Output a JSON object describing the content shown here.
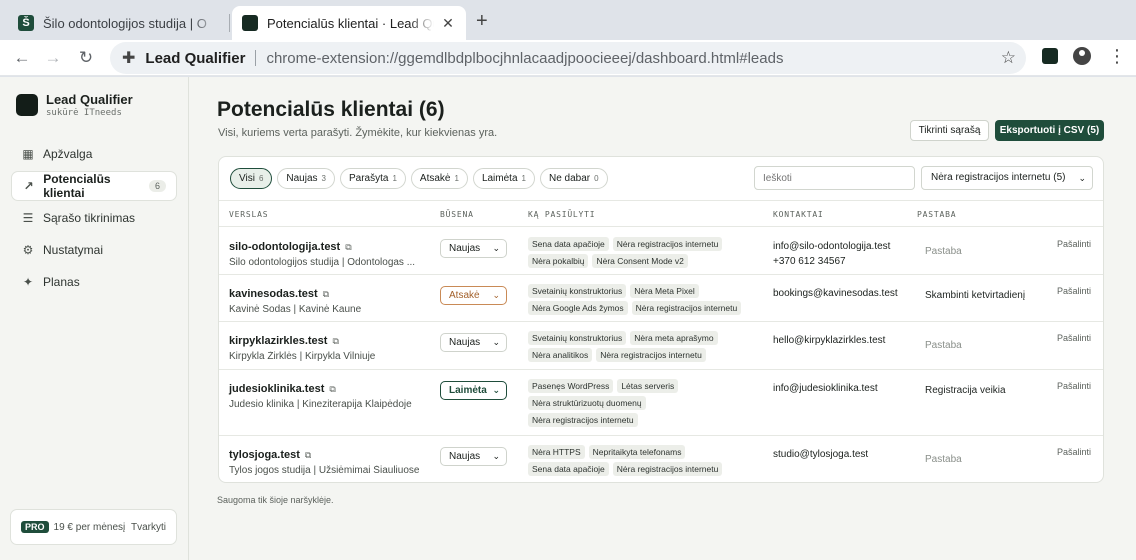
{
  "browser": {
    "tabs": [
      {
        "title": "Šilo odontologijos studija | O",
        "favicon": "Š",
        "active": false
      },
      {
        "title": "Potencialūs klientai · Lead Qualifier",
        "active": true
      }
    ],
    "new_tab": "+",
    "site_label": "Lead Qualifier",
    "url": "chrome-extension://ggemdlbdplbocjhnlacaadjpoocieeej/dashboard.html#leads"
  },
  "sidebar": {
    "brand_name": "Lead Qualifier",
    "brand_sub": "sukūrė ITneeds",
    "items": [
      {
        "label": "Apžvalga",
        "icon": "grid-icon"
      },
      {
        "label": "Potencialūs klientai",
        "icon": "leads-icon",
        "count": "6"
      },
      {
        "label": "Sąrašo tikrinimas",
        "icon": "list-check-icon"
      },
      {
        "label": "Nustatymai",
        "icon": "sliders-icon"
      },
      {
        "label": "Planas",
        "icon": "sparkle-icon"
      }
    ],
    "plan": {
      "badge": "PRO",
      "price": "19 € per mėnesį",
      "manage": "Tvarkyti"
    }
  },
  "main": {
    "title": "Potencialūs klientai (6)",
    "subtitle": "Visi, kuriems verta parašyti. Žymėkite, kur kiekvienas yra.",
    "check_button": "Tikrinti sąrašą",
    "export_button": "Eksportuoti į CSV (5)",
    "filters": [
      {
        "label": "Visi",
        "count": "6",
        "active": true
      },
      {
        "label": "Naujas",
        "count": "3"
      },
      {
        "label": "Parašyta",
        "count": "1"
      },
      {
        "label": "Atsakė",
        "count": "1"
      },
      {
        "label": "Laimėta",
        "count": "1"
      },
      {
        "label": "Ne dabar",
        "count": "0"
      }
    ],
    "search_placeholder": "Ieškoti",
    "select_value": "Nėra registracijos internetu (5)",
    "columns": [
      "VERSLAS",
      "BŪSENA",
      "KĄ PASIŪLYTI",
      "KONTAKTAI",
      "PASTABA"
    ],
    "rows": [
      {
        "domain": "silo-odontologija.test",
        "name": "Šilo odontologijos studija | Odontologas ...",
        "status": "Naujas",
        "tags": [
          "Sena data apačioje",
          "Nėra registracijos internetu",
          "Nėra pokalbių",
          "Nėra Consent Mode v2"
        ],
        "contact1": "info@silo-odontologija.test",
        "contact2": "+370 612 34567",
        "note": "Pastaba",
        "note_placeholder": true,
        "remove": "Pašalinti"
      },
      {
        "domain": "kavinesodas.test",
        "name": "Kavinė Sodas | Kavinė Kaune",
        "status": "Atsakė",
        "tags": [
          "Svetainių konstruktorius",
          "Nėra Meta Pixel",
          "Nėra Google Ads žymos",
          "Nėra registracijos internetu"
        ],
        "contact1": "bookings@kavinesodas.test",
        "contact2": "",
        "note": "Skambinti ketvirtadienį",
        "note_placeholder": false,
        "remove": "Pašalinti"
      },
      {
        "domain": "kirpyklazirkles.test",
        "name": "Kirpykla Žirklės | Kirpykla Vilniuje",
        "status": "Naujas",
        "tags": [
          "Svetainių konstruktorius",
          "Nėra meta aprašymo",
          "Nėra analitikos",
          "Nėra registracijos internetu"
        ],
        "contact1": "hello@kirpyklazirkles.test",
        "contact2": "",
        "note": "Pastaba",
        "note_placeholder": true,
        "remove": "Pašalinti"
      },
      {
        "domain": "judesioklinika.test",
        "name": "Judesio klinika | Kineziterapija Klaipėdoje",
        "status": "Laimėta",
        "tags": [
          "Pasenęs WordPress",
          "Lėtas serveris",
          "Nėra struktūrizuotų duomenų",
          "Nėra registracijos internetu"
        ],
        "contact1": "info@judesioklinika.test",
        "contact2": "",
        "note": "Registracija veikia",
        "note_placeholder": false,
        "remove": "Pašalinti"
      },
      {
        "domain": "tylosjoga.test",
        "name": "Tylos jogos studija | Užsiėmimai Šiauliuose",
        "status": "Naujas",
        "tags": [
          "Nėra HTTPS",
          "Nepritaikyta telefonams",
          "Sena data apačioje",
          "Nėra registracijos internetu"
        ],
        "contact1": "studio@tylosjoga.test",
        "contact2": "",
        "note": "Pastaba",
        "note_placeholder": true,
        "remove": "Pašalinti"
      }
    ],
    "footnote": "Saugoma tik šioje naršyklėje."
  }
}
